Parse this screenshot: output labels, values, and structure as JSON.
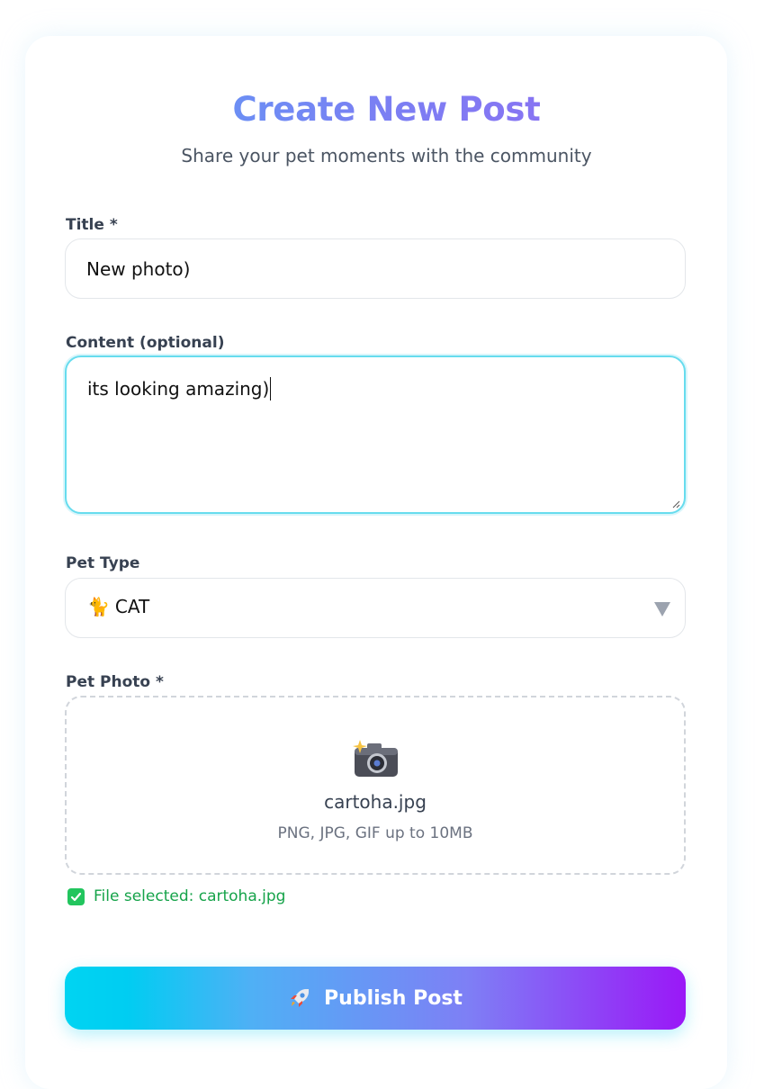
{
  "header": {
    "title": "Create New Post",
    "subtitle": "Share your pet moments with the community"
  },
  "form": {
    "title_label": "Title *",
    "title_value": "New photo)",
    "content_label": "Content (optional)",
    "content_value": "its looking amazing)",
    "pet_type_label": "Pet Type",
    "pet_type_emoji": "🐈",
    "pet_type_value": "CAT",
    "photo_label": "Pet Photo *",
    "photo_filename": "cartoha.jpg",
    "photo_hint": "PNG, JPG, GIF up to 10MB",
    "file_status": "File selected: cartoha.jpg",
    "submit_label": "Publish Post"
  },
  "icons": {
    "camera": "camera-icon",
    "check": "check-icon",
    "rocket": "rocket-icon",
    "dropdown": "chevron-down-icon"
  },
  "colors": {
    "accent_cyan": "#00d4f2",
    "accent_purple": "#9a18f7",
    "success": "#16a34a",
    "focus_border": "#67dcee"
  }
}
